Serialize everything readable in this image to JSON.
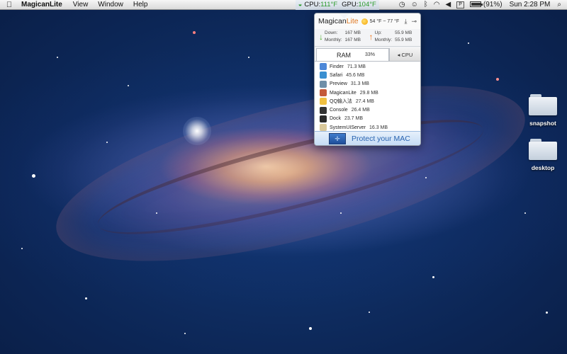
{
  "menubar": {
    "apple_icon": "apple-icon",
    "app_name": "MagicanLite",
    "menus": [
      "View",
      "Window",
      "Help"
    ],
    "cpu_label": "CPU:",
    "cpu_temp": "111°F",
    "gpu_label": "GPU:",
    "gpu_temp": "104°F",
    "battery_percent": "(91%)",
    "battery_level": 0.91,
    "clock": "Sun 2:28 PM"
  },
  "panel": {
    "brand_prefix": "Magican",
    "brand_suffix": "Lite",
    "weather": "54 °F ~ 77 °F",
    "download": {
      "down_label": "Down:",
      "down_value": "167 MB",
      "monthly_label": "Monthly:",
      "monthly_value": "167 MB"
    },
    "upload": {
      "up_label": "Up:",
      "up_value": "55.9 MB",
      "monthly_label": "Monthly:",
      "monthly_value": "55.9 MB"
    },
    "tab_ram": "RAM",
    "ram_percent": "33%",
    "tab_cpu": "◂ CPU",
    "processes": [
      {
        "name": "Finder",
        "memory": "71.3 MB",
        "color": "#4d88d8"
      },
      {
        "name": "Safari",
        "memory": "45.6 MB",
        "color": "#3a8fd0"
      },
      {
        "name": "Preview",
        "memory": "31.3 MB",
        "color": "#6f8fa8"
      },
      {
        "name": "MagicanLite",
        "memory": "29.8 MB",
        "color": "#c45a3a"
      },
      {
        "name": "QQ输入法",
        "memory": "27.4 MB",
        "color": "#f0c040"
      },
      {
        "name": "Console",
        "memory": "26.4 MB",
        "color": "#333333"
      },
      {
        "name": "Dock",
        "memory": "23.7 MB",
        "color": "#2a2a2a"
      },
      {
        "name": "SystemUIServer",
        "memory": "16.3 MB",
        "color": "#d9c89a"
      }
    ],
    "banner_text": "Protect your MAC"
  },
  "desktop": {
    "items": [
      {
        "label": "snapshot"
      },
      {
        "label": "desktop"
      }
    ]
  }
}
